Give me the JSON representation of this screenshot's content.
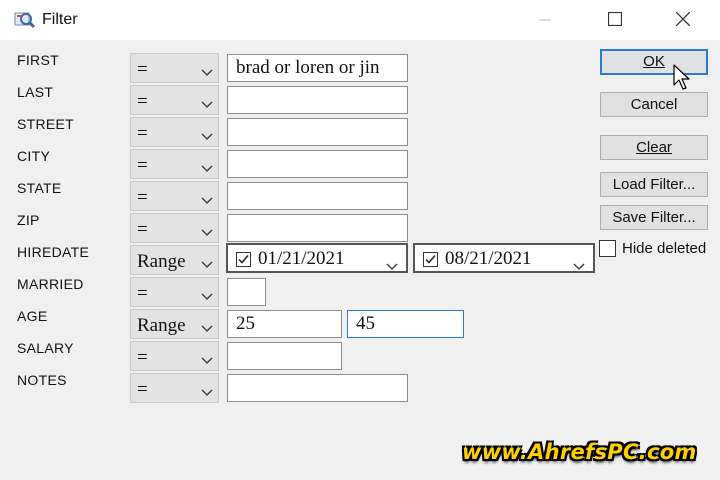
{
  "window": {
    "title": "Filter",
    "icon": "filter-app-icon",
    "controls": [
      "minimize-icon",
      "maximize-icon",
      "close-icon"
    ]
  },
  "fields": [
    {
      "label": "FIRST",
      "operator": "=",
      "value": "brad or loren or jin"
    },
    {
      "label": "LAST",
      "operator": "=",
      "value": ""
    },
    {
      "label": "STREET",
      "operator": "=",
      "value": ""
    },
    {
      "label": "CITY",
      "operator": "=",
      "value": ""
    },
    {
      "label": "STATE",
      "operator": "=",
      "value": ""
    },
    {
      "label": "ZIP",
      "operator": "=",
      "value": ""
    },
    {
      "label": "HIREDATE",
      "operator": "Range",
      "from": "01/21/2021",
      "to": "08/21/2021",
      "from_checked": true,
      "to_checked": true
    },
    {
      "label": "MARRIED",
      "operator": "=",
      "value": ""
    },
    {
      "label": "AGE",
      "operator": "Range",
      "from": "25",
      "to": "45"
    },
    {
      "label": "SALARY",
      "operator": "=",
      "value": ""
    },
    {
      "label": "NOTES",
      "operator": "=",
      "value": ""
    }
  ],
  "buttons": {
    "ok_label": "OK",
    "cancel_label": "Cancel",
    "clear_label": "Clear",
    "load_label": "Load Filter...",
    "save_label": "Save Filter..."
  },
  "hide_deleted": {
    "label": "Hide deleted",
    "checked": false
  },
  "watermark": "www.AhrefsPC.com",
  "colors": {
    "accent": "#2a7bd6",
    "background": "#f0f0f0",
    "watermark": "#ffd000"
  }
}
